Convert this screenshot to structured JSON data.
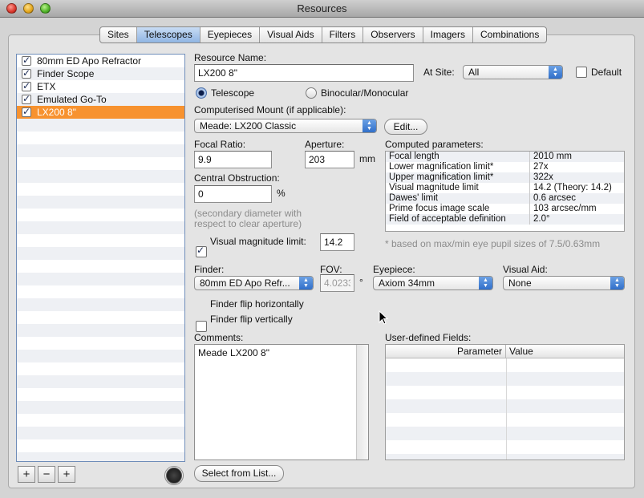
{
  "window": {
    "title": "Resources"
  },
  "tabs": [
    {
      "label": "Sites",
      "active": false
    },
    {
      "label": "Telescopes",
      "active": true
    },
    {
      "label": "Eyepieces",
      "active": false
    },
    {
      "label": "Visual Aids",
      "active": false
    },
    {
      "label": "Filters",
      "active": false
    },
    {
      "label": "Observers",
      "active": false
    },
    {
      "label": "Imagers",
      "active": false
    },
    {
      "label": "Combinations",
      "active": false
    }
  ],
  "telescope_list": [
    {
      "label": "80mm ED Apo Refractor",
      "checked": true,
      "selected": false
    },
    {
      "label": "Finder Scope",
      "checked": true,
      "selected": false
    },
    {
      "label": "ETX",
      "checked": true,
      "selected": false
    },
    {
      "label": "Emulated Go-To",
      "checked": true,
      "selected": false
    },
    {
      "label": "LX200 8\"",
      "checked": true,
      "selected": true
    }
  ],
  "list_buttons": {
    "add": "+",
    "remove": "−",
    "duplicate": "+"
  },
  "form": {
    "resource_name_label": "Resource Name:",
    "resource_name_value": "LX200 8\"",
    "at_site_label": "At Site:",
    "at_site_value": "All",
    "default_label": "Default",
    "default_checked": false,
    "type_telescope_label": "Telescope",
    "type_binocular_label": "Binocular/Monocular",
    "mount_label": "Computerised Mount (if applicable):",
    "mount_value": "Meade: LX200 Classic",
    "edit_button": "Edit...",
    "focal_ratio_label": "Focal Ratio:",
    "focal_ratio_value": "9.9",
    "aperture_label": "Aperture:",
    "aperture_value": "203",
    "aperture_unit": "mm",
    "central_obstruction_label": "Central Obstruction:",
    "central_obstruction_value": "0",
    "central_obstruction_unit": "%",
    "obstruction_note_line1": "(secondary diameter with",
    "obstruction_note_line2": "respect to clear aperture)",
    "visual_mag_limit_label": "Visual magnitude limit:",
    "visual_mag_limit_checked": true,
    "visual_mag_limit_value": "14.2",
    "finder_label": "Finder:",
    "finder_value": "80mm ED Apo Refr...",
    "fov_label": "FOV:",
    "fov_value": "4.0233",
    "fov_unit": "°",
    "eyepiece_label": "Eyepiece:",
    "eyepiece_value": "Axiom 34mm",
    "visual_aid_label": "Visual Aid:",
    "visual_aid_value": "None",
    "finder_flip_h_label": "Finder flip horizontally",
    "finder_flip_v_label": "Finder flip vertically",
    "comments_label": "Comments:",
    "comments_value": "Meade LX200 8\"",
    "user_fields_label": "User-defined Fields:",
    "user_fields_col_parameter": "Parameter",
    "user_fields_col_value": "Value",
    "select_from_list_button": "Select from List..."
  },
  "computed": {
    "label": "Computed parameters:",
    "rows": [
      {
        "k": "Focal length",
        "v": "2010 mm"
      },
      {
        "k": "Lower magnification limit*",
        "v": "27x"
      },
      {
        "k": "Upper magnification limit*",
        "v": "322x"
      },
      {
        "k": "Visual magnitude limit",
        "v": "14.2 (Theory: 14.2)"
      },
      {
        "k": "Dawes' limit",
        "v": "0.6 arcsec"
      },
      {
        "k": "Prime focus image scale",
        "v": "103 arcsec/mm"
      },
      {
        "k": "Field of acceptable definition",
        "v": "2.0°"
      }
    ],
    "footnote": "* based on max/min eye pupil sizes of 7.5/0.63mm"
  },
  "colors": {
    "selection": "#f7922f",
    "tab_active": "#8fb5e3",
    "popup_arrow": "#2d6cc8"
  }
}
